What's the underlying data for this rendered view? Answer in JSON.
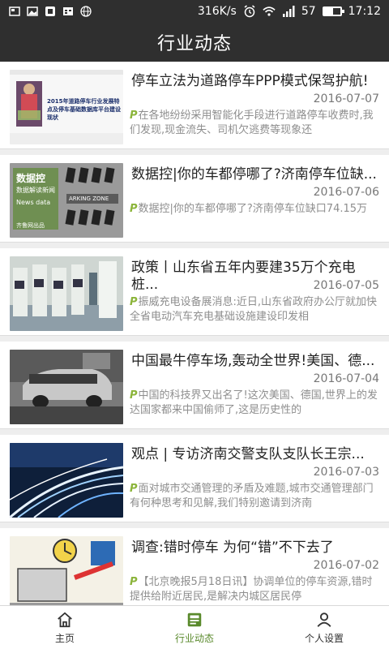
{
  "status_bar": {
    "speed": "316K/s",
    "battery": "57",
    "battery_level": 0.57,
    "time": "17:12",
    "icons": [
      "notification-icon",
      "image-icon",
      "app-icon",
      "calendar-icon",
      "globe-icon",
      "alarm-icon",
      "wifi-icon",
      "signal-icon",
      "battery-icon"
    ]
  },
  "header": {
    "title": "行业动态"
  },
  "articles": [
    {
      "title": "停车立法为道路停车PPP模式保驾护航!",
      "date": "2016-07-07",
      "badge": "P",
      "summary": "在各地纷纷采用智能化手段进行道路停车收费时,我们发现,现金流失、司机欠逃费等现象还",
      "thumb_caption": "2015年道路停车行业发展特点及停车基础数据库平台建设现状"
    },
    {
      "title": "数据控|你的车都停哪了?济南停车位缺...",
      "date": "2016-07-06",
      "badge": "P",
      "summary": "数据控|你的车都停哪了?济南停车位缺口74.15万",
      "thumb_text_1": "数据控",
      "thumb_text_2": "数据解读新闻",
      "thumb_text_3": "News data",
      "thumb_text_4": "ARKING ZONE",
      "thumb_text_5": "齐鲁网出品"
    },
    {
      "title": "政策丨山东省五年内要建35万个充电桩...",
      "date": "2016-07-05",
      "badge": "P",
      "summary": "振威充电设备展消息:近日,山东省政府办公厅就加快全省电动汽车充电基础设施建设印发相"
    },
    {
      "title": "中国最牛停车场,轰动全世界!美国、德...",
      "date": "2016-07-04",
      "badge": "P",
      "summary": "中国的科技界又出名了!这次美国、德国,世界上的发达国家都来中国偷师了,这是历史性的"
    },
    {
      "title": "观点 | 专访济南交警支队支队长王宗...",
      "date": "2016-07-03",
      "badge": "P",
      "summary": "面对城市交通管理的矛盾及难题,城市交通管理部门有何种思考和见解,我们特别邀请到济南"
    },
    {
      "title": "调查:错时停车 为何“错”不下去了",
      "date": "2016-07-02",
      "badge": "P",
      "summary": "【北京晚报5月18日讯】协调单位的停车资源,错时提供给附近居民,是解决内城区居民停"
    }
  ],
  "tabs": [
    {
      "label": "主页",
      "icon": "home-icon",
      "active": false
    },
    {
      "label": "行业动态",
      "icon": "news-icon",
      "active": true
    },
    {
      "label": "个人设置",
      "icon": "person-icon",
      "active": false
    }
  ],
  "colors": {
    "header_bg": "#2f2f2f",
    "accent": "#5a8a2c",
    "badge": "#8bb43a"
  }
}
